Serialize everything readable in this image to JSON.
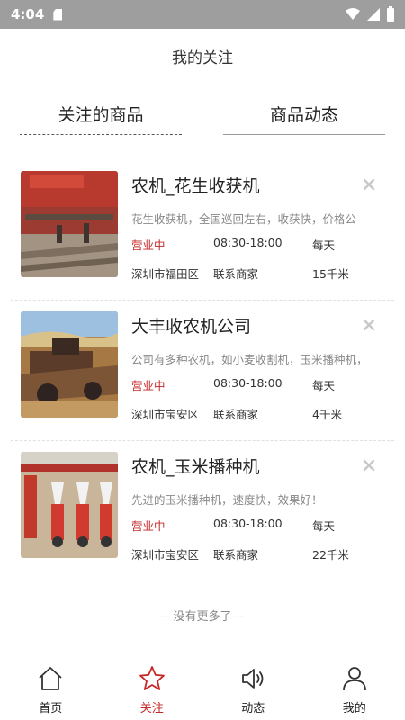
{
  "status_bar": {
    "time": "4:04"
  },
  "header": {
    "title": "我的关注"
  },
  "tabs": [
    {
      "label": "关注的商品"
    },
    {
      "label": "商品动态"
    }
  ],
  "items": [
    {
      "title": "农机_花生收获机",
      "description": "花生收获机，全国巡回左右，收获快，价格公",
      "status": "营业中",
      "hours": "08:30-18:00",
      "days": "每天",
      "location": "深圳市福田区",
      "contact": "联系商家",
      "distance": "15千米",
      "image": "peanut-harvester-photo"
    },
    {
      "title": "大丰收农机公司",
      "description": "公司有多种农机，如小麦收割机，玉米播种机，",
      "status": "营业中",
      "hours": "08:30-18:00",
      "days": "每天",
      "location": "深圳市宝安区",
      "contact": "联系商家",
      "distance": "4千米",
      "image": "combine-harvester-photo"
    },
    {
      "title": "农机_玉米播种机",
      "description": "先进的玉米播种机，速度快，效果好！",
      "status": "营业中",
      "hours": "08:30-18:00",
      "days": "每天",
      "location": "深圳市宝安区",
      "contact": "联系商家",
      "distance": "22千米",
      "image": "corn-seeder-photo"
    }
  ],
  "footer_note": "-- 没有更多了 --",
  "nav": [
    {
      "label": "首页",
      "icon": "home-icon",
      "active": false
    },
    {
      "label": "关注",
      "icon": "star-icon",
      "active": true
    },
    {
      "label": "动态",
      "icon": "speaker-icon",
      "active": false
    },
    {
      "label": "我的",
      "icon": "user-icon",
      "active": false
    }
  ],
  "colors": {
    "accent": "#c62828",
    "status_bar": "#9e9e9e",
    "text": "#222222",
    "muted": "#888888"
  }
}
